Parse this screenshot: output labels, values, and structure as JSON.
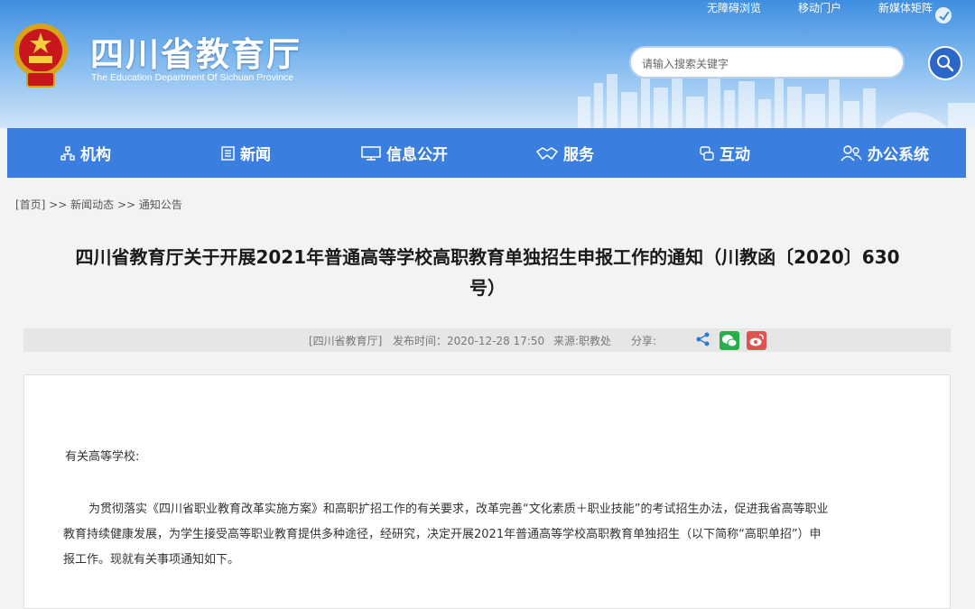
{
  "header": {
    "site_title": "四川省教育厅",
    "site_subtitle": "The Education Department Of Sichuan Province",
    "top_links": [
      "无障碍浏览",
      "移动门户",
      "新媒体矩阵"
    ],
    "search_placeholder": "请输入搜索关键字"
  },
  "nav": {
    "items": [
      {
        "label": "机构",
        "icon": "org-icon"
      },
      {
        "label": "新闻",
        "icon": "news-icon"
      },
      {
        "label": "信息公开",
        "icon": "monitor-icon"
      },
      {
        "label": "服务",
        "icon": "service-icon"
      },
      {
        "label": "互动",
        "icon": "interaction-icon"
      },
      {
        "label": "办公系统",
        "icon": "users-icon"
      }
    ]
  },
  "breadcrumb": {
    "home": "[首页]",
    "sep": ">>",
    "level1": "新闻动态",
    "level2": "通知公告"
  },
  "article": {
    "title_line1": "四川省教育厅关于开展2021年普通高等学校高职教育单独招生申报工作的通知（川教函〔2020〕630",
    "title_line2": "号）",
    "source": "[四川省教育厅]",
    "publish_time": "发布时间：2020-12-28 17:50",
    "origin": "来源:职教处",
    "share_label": "分享:",
    "greeting": "有关高等学校:",
    "paragraph_lines": [
      "为贯彻落实《四川省职业教育改革实施方案》和高职扩招工作的有关要求，改革完善“文化素质＋职业技能”的考试招生办法，促进我省高等职业",
      "教育持续健康发展，为学生接受高等职业教育提供多种途径，经研究，决定开展2021年普通高等学校高职教育单独招生（以下简称“高职单招”）申",
      "报工作。现就有关事项通知如下。"
    ]
  },
  "colors": {
    "nav_bg": "#3a7fe0",
    "search_button": "#2b66c9",
    "wechat_green": "#2aae4b",
    "weibo_red": "#e0524f"
  }
}
